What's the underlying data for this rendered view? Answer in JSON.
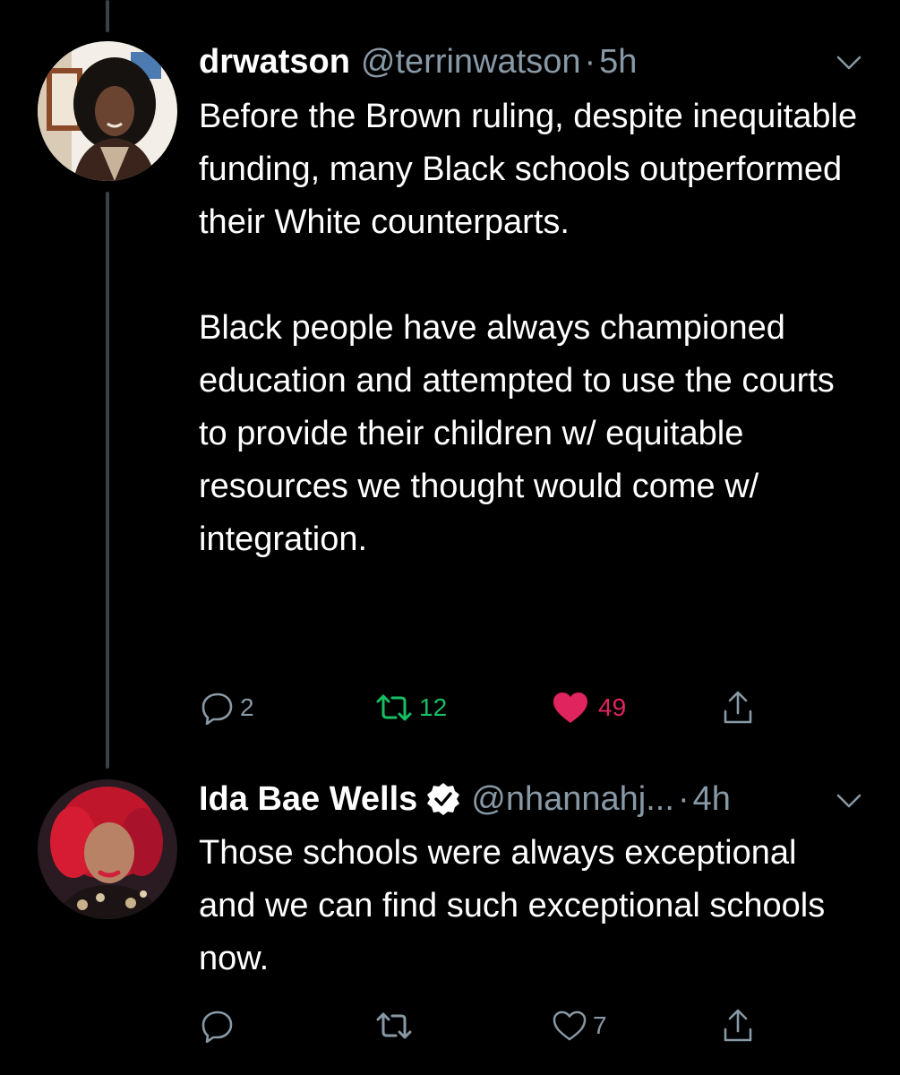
{
  "tweets": [
    {
      "name": "drwatson",
      "handle": "@terrinwatson",
      "separator": "·",
      "time": "5h",
      "body": [
        "Before the Brown ruling, despite inequitable funding, many Black schools outperformed their White counterparts.",
        "Black people have always championed education and attempted to use the courts to provide their children w/ equitable resources we thought would come w/ integration."
      ],
      "replies": "2",
      "retweets": "12",
      "likes": "49",
      "retweeted": true,
      "liked": true
    },
    {
      "name": "Ida Bae Wells",
      "verified": true,
      "handle": "@nhannahj...",
      "separator": "·",
      "time": "4h",
      "body": [
        "Those schools were always exceptional and we can find such exceptional schools now."
      ],
      "replies": "",
      "retweets": "",
      "likes": "7",
      "retweeted": false,
      "liked": false
    }
  ],
  "colors": {
    "background": "#000000",
    "text": "#ffffff",
    "muted": "#8899a6",
    "retweet_green": "#17bf63",
    "like_red": "#e0245e",
    "thread_line": "#3d4146"
  },
  "icons": [
    "reply-icon",
    "retweet-icon",
    "like-icon",
    "share-icon",
    "caret-down-icon",
    "verified-badge-icon"
  ]
}
